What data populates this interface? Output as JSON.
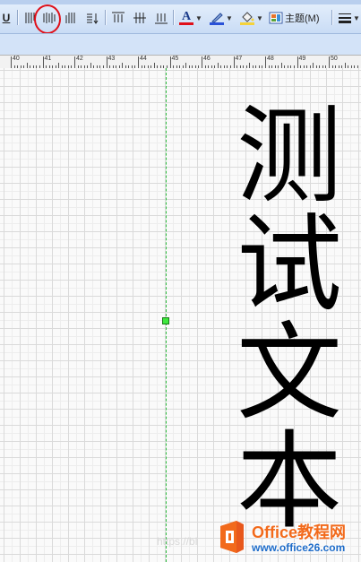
{
  "toolbar": {
    "underline_label": "U",
    "font_color_label": "A",
    "theme_label": "主题(M)",
    "accent_colors": {
      "font_color": "#e0101a",
      "highlight": "#2a52d8",
      "fill": "#f5d33b",
      "circle": "#e0101a"
    }
  },
  "ruler": {
    "labels": [
      "40",
      "41",
      "42",
      "43",
      "44",
      "45",
      "46",
      "47",
      "48",
      "49",
      "50"
    ]
  },
  "canvas": {
    "vertical_text": "测试文本",
    "text_color": "#000000"
  },
  "watermark": {
    "brand": "Office教程网",
    "url": "www.office26.com",
    "faint_url": "https://bl"
  }
}
